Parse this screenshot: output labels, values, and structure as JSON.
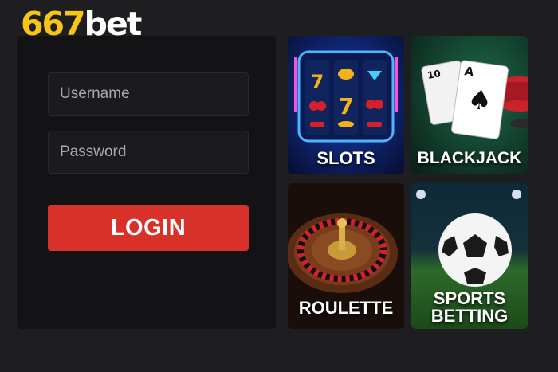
{
  "logo": {
    "number": "667",
    "word": "bet"
  },
  "login": {
    "username_placeholder": "Username",
    "password_placeholder": "Password",
    "login_label": "LOGIN"
  },
  "games": {
    "slots": "SLOTS",
    "blackjack": "BLACKJACK",
    "roulette": "ROULETTE",
    "sports_line1": "SPORTS",
    "sports_line2": "BETTING"
  },
  "colors": {
    "background": "#1e1e20",
    "panel": "#131315",
    "accent_red": "#d8312a",
    "logo_yellow": "#f5c518"
  }
}
